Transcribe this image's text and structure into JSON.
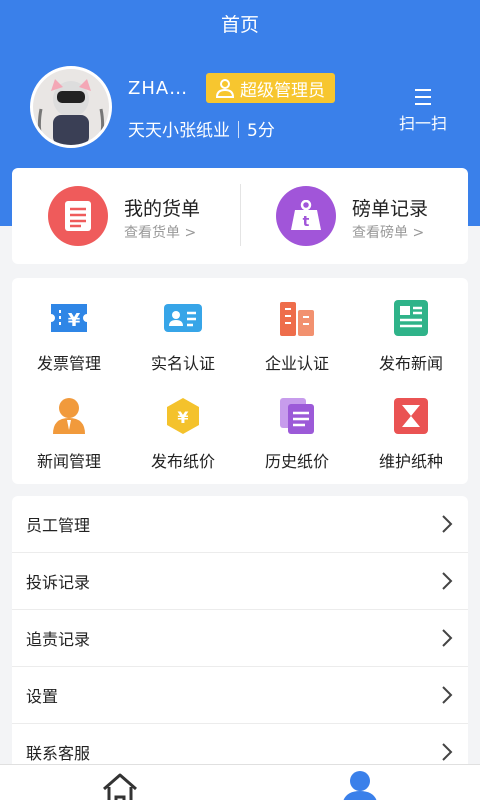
{
  "header": {
    "title": "首页"
  },
  "profile": {
    "username": "ZHA…",
    "role_badge": "超级管理员",
    "company_line": "天天小张纸业｜5分"
  },
  "scan": {
    "label": "扫一扫",
    "icon": "scan-menu-icon"
  },
  "quick_actions": [
    {
      "title": "我的货单",
      "subtitle": "查看货单 >",
      "icon": "invoice-list-icon",
      "color": "#ef5b5b"
    },
    {
      "title": "磅单记录",
      "subtitle": "查看磅单 >",
      "icon": "weight-icon",
      "color": "#a155d9"
    }
  ],
  "grid": [
    {
      "label": "发票管理",
      "icon": "yen-ticket-icon",
      "color": "#2f86e6"
    },
    {
      "label": "实名认证",
      "icon": "id-card-icon",
      "color": "#37a5e8"
    },
    {
      "label": "企业认证",
      "icon": "building-icon",
      "color": "#ee6d4b"
    },
    {
      "label": "发布新闻",
      "icon": "news-icon",
      "color": "#2fb389"
    },
    {
      "label": "新闻管理",
      "icon": "person-icon",
      "color": "#f19a3c"
    },
    {
      "label": "发布纸价",
      "icon": "price-hexagon-icon",
      "color": "#f4c22c"
    },
    {
      "label": "历史纸价",
      "icon": "documents-icon",
      "color": "#9c5ad8"
    },
    {
      "label": "维护纸种",
      "icon": "hourglass-icon",
      "color": "#ea5353"
    }
  ],
  "list": [
    {
      "label": "员工管理"
    },
    {
      "label": "投诉记录"
    },
    {
      "label": "追责记录"
    },
    {
      "label": "设置"
    },
    {
      "label": "联系客服"
    }
  ],
  "tabbar": {
    "home_icon": "home-icon",
    "me_icon": "person-icon",
    "accent": "#3a80ea"
  }
}
